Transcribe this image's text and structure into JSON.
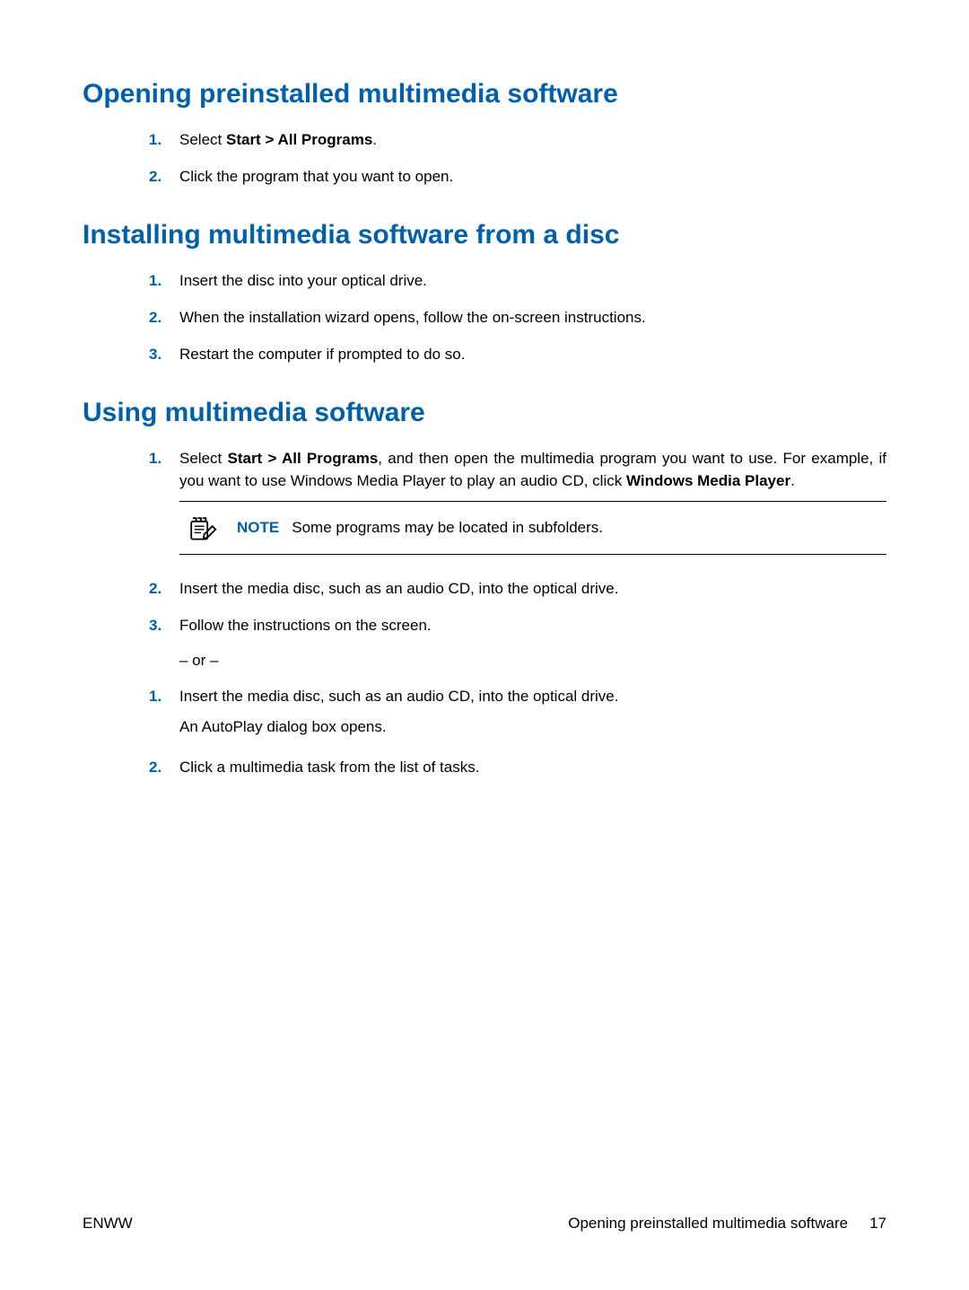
{
  "section1": {
    "heading": "Opening preinstalled multimedia software",
    "items": [
      {
        "num": "1.",
        "pre": "Select ",
        "bold": "Start > All Programs",
        "post": "."
      },
      {
        "num": "2.",
        "text": "Click the program that you want to open."
      }
    ]
  },
  "section2": {
    "heading": "Installing multimedia software from a disc",
    "items": [
      {
        "num": "1.",
        "text": "Insert the disc into your optical drive."
      },
      {
        "num": "2.",
        "text": "When the installation wizard opens, follow the on-screen instructions."
      },
      {
        "num": "3.",
        "text": "Restart the computer if prompted to do so."
      }
    ]
  },
  "section3": {
    "heading": "Using multimedia software",
    "listA": {
      "item1": {
        "num": "1.",
        "pre": "Select ",
        "bold1": "Start > All Programs",
        "mid": ", and then open the multimedia program you want to use. For example, if you want to use Windows Media Player to play an audio CD, click ",
        "bold2": "Windows Media Player",
        "post": "."
      },
      "note": {
        "label": "NOTE",
        "text": "Some programs may be located in subfolders."
      },
      "item2": {
        "num": "2.",
        "text": "Insert the media disc, such as an audio CD, into the optical drive."
      },
      "item3": {
        "num": "3.",
        "text": "Follow the instructions on the screen."
      }
    },
    "or": "– or –",
    "listB": {
      "item1": {
        "num": "1.",
        "text": "Insert the media disc, such as an audio CD, into the optical drive.",
        "sub": "An AutoPlay dialog box opens."
      },
      "item2": {
        "num": "2.",
        "text": "Click a multimedia task from the list of tasks."
      }
    }
  },
  "footer": {
    "left": "ENWW",
    "rightText": "Opening preinstalled multimedia software",
    "pageNum": "17"
  }
}
